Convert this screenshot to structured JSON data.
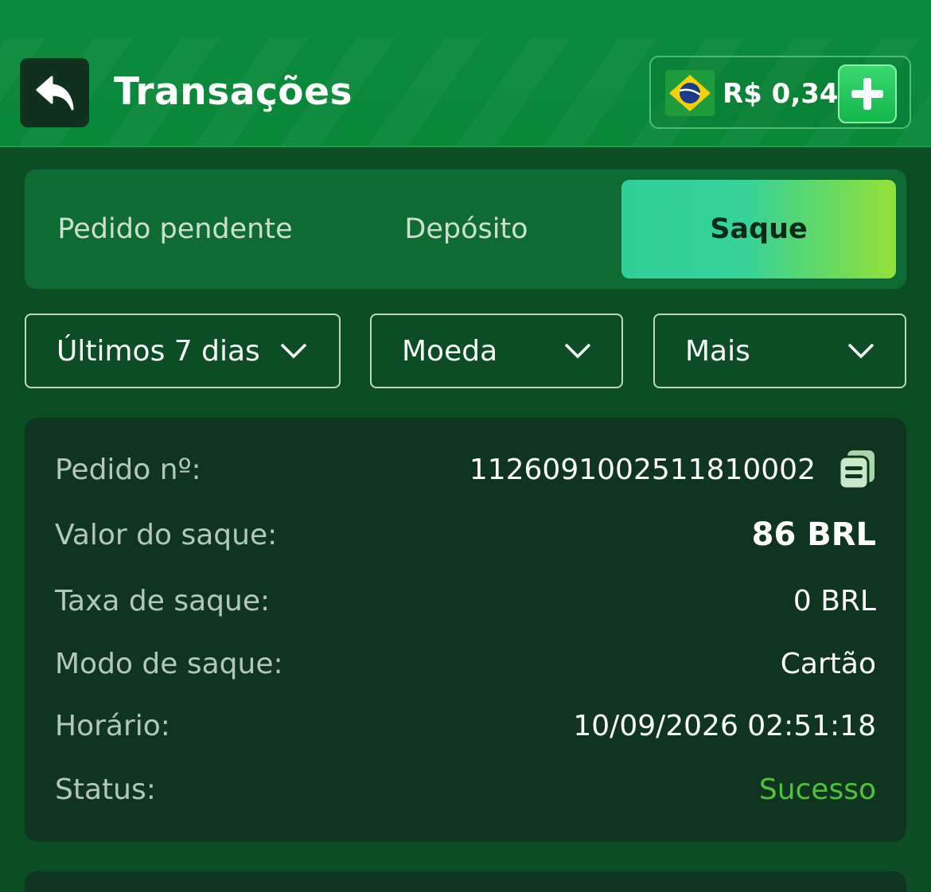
{
  "header": {
    "title": "Transações",
    "balance": "R$ 0,34",
    "back_icon": "back-arrow-icon",
    "add_icon": "plus-icon",
    "flag_icon": "brazil-flag-icon"
  },
  "tabs": [
    {
      "label": "Pedido pendente",
      "active": false
    },
    {
      "label": "Depósito",
      "active": false
    },
    {
      "label": "Saque",
      "active": true
    }
  ],
  "filters": [
    {
      "label": "Últimos 7 dias"
    },
    {
      "label": "Moeda"
    },
    {
      "label": "Mais"
    }
  ],
  "transaction": {
    "order_label": "Pedido nº:",
    "order_value": "1126091002511810002",
    "amount_label": "Valor do saque:",
    "amount_value": "86 BRL",
    "fee_label": "Taxa de saque:",
    "fee_value": "0 BRL",
    "mode_label": "Modo de saque:",
    "mode_value": "Cartão",
    "time_label": "Horário:",
    "time_value": "10/09/2026 02:51:18",
    "status_label": "Status:",
    "status_value": "Sucesso"
  },
  "colors": {
    "header_bg": "#098838",
    "page_bg": "#0c4d26",
    "card_bg": "#0f3520",
    "success": "#4fc23b",
    "active_tab_start": "#2fcf98",
    "active_tab_end": "#95e037"
  }
}
